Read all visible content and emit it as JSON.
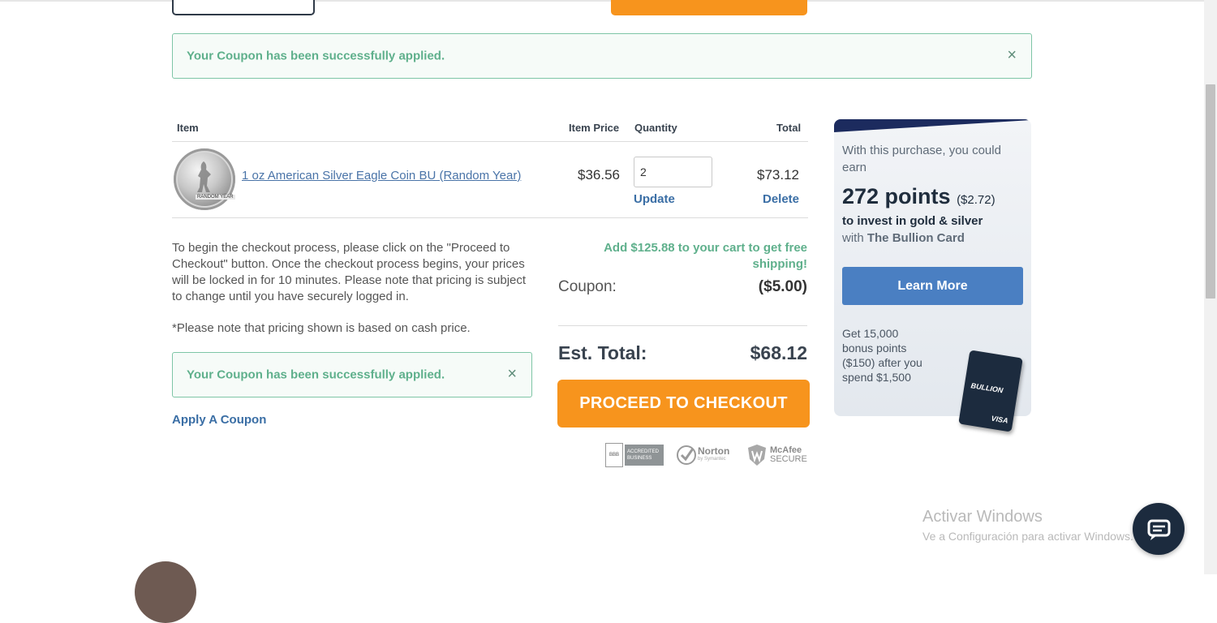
{
  "alert_top": {
    "message": "Your Coupon has been successfully applied.",
    "close": "×"
  },
  "cart": {
    "headers": {
      "item": "Item",
      "item_price": "Item Price",
      "quantity": "Quantity",
      "total": "Total"
    },
    "row": {
      "name": "1 oz American Silver Eagle Coin BU (Random Year)",
      "coin_caption": "RANDOM YEAR",
      "price": "$36.56",
      "quantity": "2",
      "total": "$73.12",
      "update": "Update",
      "delete": "Delete"
    }
  },
  "info": {
    "paragraph": "To begin the checkout process, please click on the \"Proceed to Checkout\" button. Once the checkout process begins, your prices will be locked in for 10 minutes. Please note that pricing is subject to change until you have securely logged in.",
    "note": "*Please note that pricing shown is based on cash price."
  },
  "alert_bottom": {
    "message": "Your Coupon has been successfully applied.",
    "close": "×"
  },
  "apply_coupon": "Apply A Coupon",
  "summary": {
    "free_shipping": "Add $125.88 to your cart to get free shipping!",
    "coupon_label": "Coupon:",
    "coupon_value": "($5.00)",
    "est_label": "Est. Total:",
    "est_value": "$68.12",
    "checkout": "PROCEED TO CHECKOUT"
  },
  "badges": {
    "bbb": "ACCREDITED BUSINESS",
    "bbb_short": "BBB",
    "norton": "Norton",
    "norton_sub": "by Symantec",
    "mcafee": "McAfee",
    "mcafee_sub": "SECURE"
  },
  "promo": {
    "intro": "With this purchase, you could earn",
    "points": "272 points",
    "points_value": "($2.72)",
    "invest_line": "to invest in gold & silver",
    "with": "with",
    "card_name": "The Bullion Card",
    "learn_more": "Learn More",
    "bonus": "Get 15,000 bonus points ($150) after you spend $1,500",
    "card_label": "BULLION",
    "card_network": "VISA"
  },
  "watermark": {
    "title": "Activar Windows",
    "subtitle": "Ve a Configuración para activar Windows."
  },
  "colors": {
    "accent_orange": "#f7941d",
    "success_green": "#5fb08c",
    "link_blue": "#3a6ea5",
    "navy": "#1c2b3e"
  },
  "icons": {
    "chat": "chat-bubble-icon",
    "close": "close-icon"
  }
}
